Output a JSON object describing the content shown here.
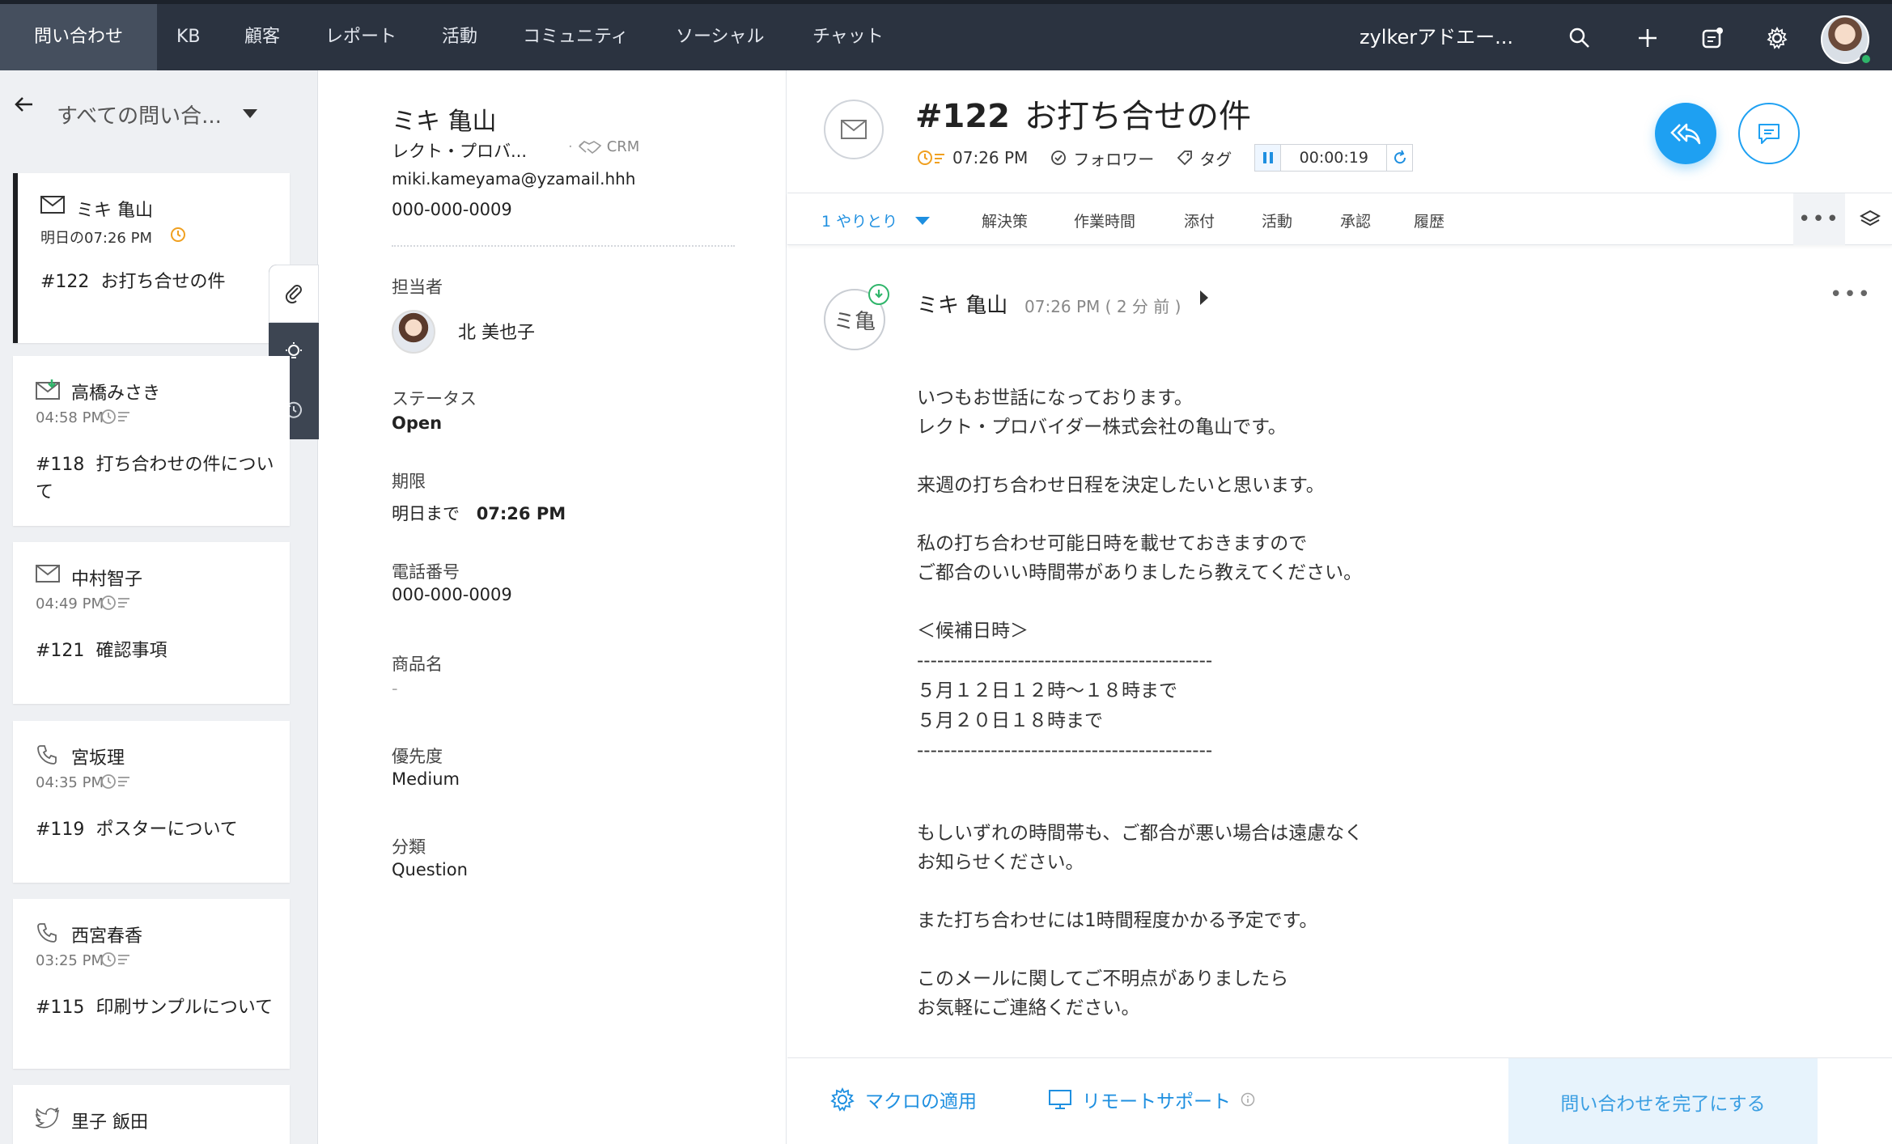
{
  "topnav": {
    "tabs": [
      "問い合わせ",
      "KB",
      "顧客",
      "レポート",
      "活動",
      "コミュニティ",
      "ソーシャル",
      "チャット"
    ],
    "org": "zylkerアドエー...",
    "icons": [
      "search-icon",
      "plus-icon",
      "notes-icon",
      "gear-icon",
      "user-avatar"
    ]
  },
  "list": {
    "view": "すべての問い合...",
    "tickets": [
      {
        "channel": "email",
        "name": "ミキ 亀山",
        "time": "明日の07:26 PM",
        "number": "#122",
        "subject": "お打ち合せの件"
      },
      {
        "channel": "email-in",
        "name": "高橋みさき",
        "time": "04:58 PM",
        "number": "#118",
        "subject": "打ち合わせの件について"
      },
      {
        "channel": "email",
        "name": "中村智子",
        "time": "04:49 PM",
        "number": "#121",
        "subject": "確認事項"
      },
      {
        "channel": "phone",
        "name": "宮坂理",
        "time": "04:35 PM",
        "number": "#119",
        "subject": "ポスターについて"
      },
      {
        "channel": "phone",
        "name": "西宮春香",
        "time": "03:25 PM",
        "number": "#115",
        "subject": "印刷サンプルについて"
      },
      {
        "channel": "twitter",
        "name": "里子 飯田",
        "time": "",
        "number": "",
        "subject": ""
      }
    ]
  },
  "contact": {
    "name": "ミキ 亀山",
    "company": "レクト・プロバ...",
    "crm": "CRM",
    "email": "miki.kameyama@yzamail.hhh",
    "phone": "000-000-0009",
    "assignee_label": "担当者",
    "assignee": "北 美也子",
    "status_label": "ステータス",
    "status": "Open",
    "due_label": "期限",
    "due_prefix": "明日まで",
    "due_time": "07:26 PM",
    "tel_label": "電話番号",
    "tel": "000-000-0009",
    "product_label": "商品名",
    "product": "-",
    "priority_label": "優先度",
    "priority": "Medium",
    "class_label": "分類",
    "class": "Question"
  },
  "ticket": {
    "number": "#122",
    "title": "お打ち合せの件",
    "due_time": "07:26 PM",
    "follow": "フォロワー",
    "tag": "タグ",
    "timer": "00:00:19",
    "subtabs": [
      "1 やりとり",
      "解決策",
      "作業時間",
      "添付",
      "活動",
      "承認",
      "履歴"
    ],
    "more": "•••",
    "thread": {
      "avatar": "ミ亀",
      "from": "ミキ 亀山",
      "time": "07:26 PM ( 2 分 前 )",
      "more": "•••",
      "paragraphs": [
        "いつもお世話になっております。\nレクト・プロバイダー株式会社の亀山です。",
        "来週の打ち合わせ日程を決定したいと思います。",
        "私の打ち合わせ可能日時を載せておきますので\nご都合のいい時間帯がありましたら教えてください。",
        "＜候補日時＞\n--------------------------------------------\n５月１２日１２時〜１８時まで\n５月２０日１８時まで\n--------------------------------------------",
        "もしいずれの時間帯も、ご都合が悪い場合は遠慮なく\nお知らせください。",
        "また打ち合わせには1時間程度かかる予定です。",
        "このメールに関してご不明点がありましたら\nお気軽にご連絡ください。"
      ]
    },
    "footer": {
      "macro": "マクロの適用",
      "remote": "リモートサポート",
      "complete": "問い合わせを完了にする"
    }
  },
  "colors": {
    "nav_bg": "#2b3340",
    "nav_active": "#454f5e",
    "accent": "#1ea0f2",
    "due_orange": "#f0a020",
    "online": "#2fb56a"
  }
}
